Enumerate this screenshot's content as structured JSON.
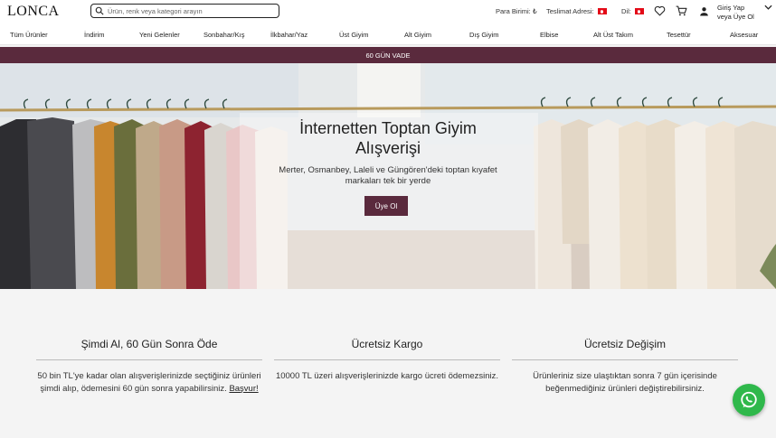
{
  "brand": {
    "logo_text": "LONCA"
  },
  "search": {
    "placeholder": "Ürün, renk veya kategori arayın"
  },
  "header": {
    "currency_label": "Para Birimi: ₺",
    "delivery_label": "Teslimat Adresi:",
    "language_label": "Dil:",
    "login_line1": "Giriş Yap",
    "login_line2": "veya Üye Ol"
  },
  "nav": {
    "items": [
      "Tüm Ürünler",
      "İndirim",
      "Yeni Gelenler",
      "Sonbahar/Kış",
      "İlkbahar/Yaz",
      "Üst Giyim",
      "Alt Giyim",
      "Dış Giyim",
      "Elbise",
      "Alt Üst Takım",
      "Tesettür",
      "Aksesuar"
    ]
  },
  "promo": {
    "text": "60 GÜN VADE"
  },
  "hero": {
    "title_line1": "İnternetten Toptan Giyim",
    "title_line2": "Alışverişi",
    "subtitle_line1": "Merter, Osmanbey, Laleli ve Güngören'deki toptan kıyafet",
    "subtitle_line2": "markaları tek bir yerde",
    "cta_label": "Üye Ol"
  },
  "features": [
    {
      "title": "Şimdi Al, 60 Gün Sonra Öde",
      "body_line1": "50 bin TL'ye kadar olan alışverişlerinizde seçtiğiniz ürünleri",
      "body_line2": "şimdi alıp, ödemesini 60 gün sonra yapabilirsiniz.",
      "link": "Başvur!"
    },
    {
      "title": "Ücretsiz Kargo",
      "body_line1": "10000 TL üzeri alışverişlerinizde kargo ücreti ödemezsiniz.",
      "body_line2": ""
    },
    {
      "title": "Ücretsiz Değişim",
      "body_line1": "Ürünleriniz size ulaştıktan sonra 7 gün içerisinde",
      "body_line2": "beğenmediğiniz ürünleri değiştirebilirsiniz."
    }
  ],
  "colors": {
    "brand": "#5a2a3d",
    "whatsapp": "#2fb84b"
  },
  "icons": [
    "search-icon",
    "flag-tr-icon",
    "heart-icon",
    "cart-icon",
    "user-icon",
    "chevron-down-icon",
    "whatsapp-icon"
  ]
}
